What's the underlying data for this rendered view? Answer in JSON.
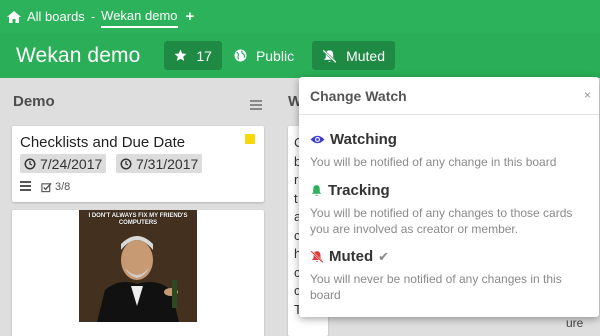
{
  "topbar": {
    "home_label": "All boards",
    "separator": "-",
    "current_board": "Wekan demo",
    "add_symbol": "+"
  },
  "board_header": {
    "title": "Wekan demo",
    "stars_count": "17",
    "visibility_label": "Public",
    "watch_label": "Muted"
  },
  "lists": [
    {
      "title": "Demo",
      "cards": [
        {
          "title": "Checklists and Due Date",
          "label_color": "#f5d90a",
          "start_date": "7/24/2017",
          "due_date": "7/31/2017",
          "checklist": "3/8"
        },
        {
          "image_caption": "I DON'T ALWAYS FIX MY FRIEND'S COMPUTERS"
        }
      ]
    },
    {
      "title": "W",
      "card_text_letters": [
        "C",
        "b",
        "r",
        "t",
        "a",
        "c",
        "h",
        "c",
        "c",
        "T"
      ],
      "peek_text": "ure"
    }
  ],
  "popup": {
    "title": "Change Watch",
    "close_symbol": "×",
    "options": [
      {
        "label": "Watching",
        "icon": "eye-icon",
        "description": "You will be notified of any change in this board",
        "selected": false
      },
      {
        "label": "Tracking",
        "icon": "bell-icon",
        "description": "You will be notified of any changes to those cards you are involved as creator or member.",
        "selected": false
      },
      {
        "label": "Muted",
        "icon": "muted-bell-icon",
        "description": "You will never be notified of any changes in this board",
        "selected": true,
        "check_symbol": "✔"
      }
    ]
  },
  "colors": {
    "topbar": "#2cb25a",
    "board_header": "#2aae58",
    "header_button": "#1f8a44",
    "eye": "#3d3dd0",
    "bell": "#2cb25a",
    "muted": "#e03b3b"
  }
}
